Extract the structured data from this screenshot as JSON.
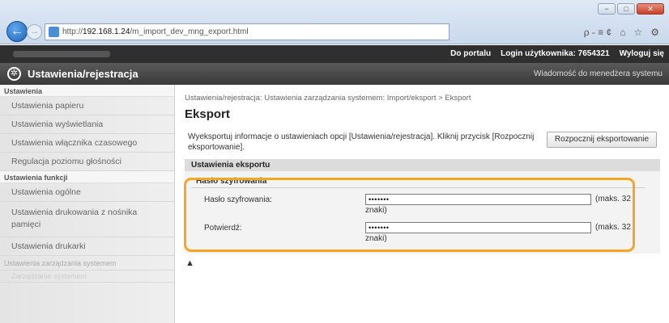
{
  "browser": {
    "url_prefix": "http://",
    "url_host": "192.168.1.24",
    "url_path": "/m_import_dev_mng_export.html",
    "search_symbols": "ρ - ≡ ¢",
    "icon_home": "⌂",
    "icon_star": "☆",
    "icon_gear": "⚙",
    "win_min": "−",
    "win_max": "□",
    "win_close": "✕"
  },
  "topbar": {
    "portal_link": "Do portalu",
    "login_label": "Login użytkownika:",
    "login_value": "7654321",
    "logout": "Wyloguj się"
  },
  "appbar": {
    "title": "Ustawienia/rejestracja",
    "message": "Wiadomość do menedżera systemu"
  },
  "sidebar": {
    "section1": "Ustawienia",
    "items1": [
      "Ustawienia papieru",
      "Ustawienia wyświetlania",
      "Ustawienia włącznika czasowego",
      "Regulacja poziomu głośności"
    ],
    "section2": "Ustawienia funkcji",
    "items2": [
      "Ustawienia ogólne",
      "Ustawienia drukowania z nośnika pamięci",
      "Ustawienia drukarki"
    ],
    "faded1": "Ustawienia zarządzania systemem",
    "faded2": "Zarządzanie systemem"
  },
  "main": {
    "breadcrumb": "Ustawienia/rejestracja: Ustawienia zarządzania systemem: Import/eksport > Eksport",
    "title": "Eksport",
    "description": "Wyeksportuj informacje o ustawieniach opcji [Ustawienia/rejestracja]. Kliknij przycisk [Rozpocznij eksportowanie].",
    "export_button": "Rozpocznij eksportowanie",
    "settings_header": "Ustawienia eksportu",
    "subheader": "Hasło szyfrowania",
    "password_label": "Hasło szyfrowania:",
    "password_value": "•••••••",
    "confirm_label": "Potwierdź:",
    "confirm_value": "•••••••",
    "hint_line1": "(maks. 32",
    "hint_line2": "znaki)",
    "top_link": "▲"
  }
}
